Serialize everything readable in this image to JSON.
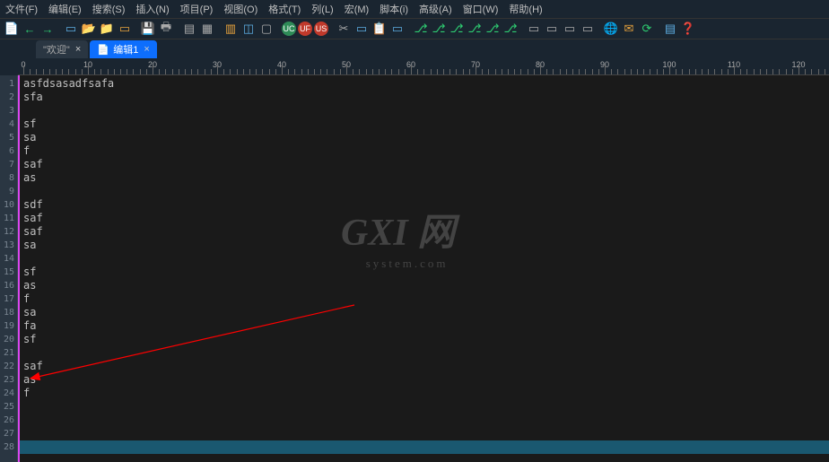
{
  "menu": {
    "file": "文件(F)",
    "edit": "编辑(E)",
    "search": "搜索(S)",
    "insert": "插入(N)",
    "project": "项目(P)",
    "view": "视图(O)",
    "format": "格式(T)",
    "column": "列(L)",
    "macro": "宏(M)",
    "script": "脚本(i)",
    "advanced": "高级(A)",
    "window": "窗口(W)",
    "help": "帮助(H)"
  },
  "tabs": {
    "welcome": "\"欢迎\"",
    "edit1": "编辑1"
  },
  "ruler_marks": [
    "0",
    "10",
    "20",
    "30",
    "40",
    "50",
    "60",
    "70",
    "80",
    "90",
    "100",
    "110",
    "120"
  ],
  "lines": {
    "l1": "asfdsasadfsafa",
    "l2": "sfa",
    "l3": "",
    "l4": "sf",
    "l5": "sa",
    "l6": "f",
    "l7": "saf",
    "l8": "as",
    "l9": "",
    "l10": "sdf",
    "l11": "saf",
    "l12": "saf",
    "l13": "sa",
    "l14": "",
    "l15": "sf",
    "l16": "as",
    "l17": "f",
    "l18": "sa",
    "l19": "fa",
    "l20": "sf",
    "l21": "",
    "l22": "saf",
    "l23": "as",
    "l24": "f",
    "l25": "",
    "l26": "",
    "l27": ""
  },
  "line_numbers": [
    "1",
    "2",
    "3",
    "4",
    "5",
    "6",
    "7",
    "8",
    "9",
    "10",
    "11",
    "12",
    "13",
    "14",
    "15",
    "16",
    "17",
    "18",
    "19",
    "20",
    "21",
    "22",
    "23",
    "24",
    "25",
    "26",
    "27",
    "28"
  ],
  "watermark": {
    "main": "GXI 网",
    "sub": "system.com"
  }
}
